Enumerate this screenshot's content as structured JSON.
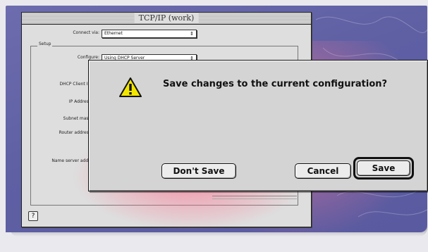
{
  "tcp_window": {
    "title": "TCP/IP (work)",
    "connect_via_label": "Connect via:",
    "connect_via_value": "Ethernet",
    "setup_label": "Setup",
    "configure_label": "Configure:",
    "configure_value": "Using DHCP Server",
    "fields": [
      {
        "label": "DHCP Client ID:"
      },
      {
        "label": "IP Address:"
      },
      {
        "label": "Subnet mask:"
      },
      {
        "label": "Router address:"
      },
      {
        "label": "Name server addr.:"
      }
    ],
    "popup_arrows": "⇕",
    "help_icon": "?"
  },
  "alert": {
    "message": "Save changes to the current configuration?",
    "icon": "warning-icon",
    "dont_save_label": "Don't Save",
    "cancel_label": "Cancel",
    "save_label": "Save"
  },
  "colors": {
    "desktop": "#6666aa",
    "warning_fill": "#f2e600"
  }
}
